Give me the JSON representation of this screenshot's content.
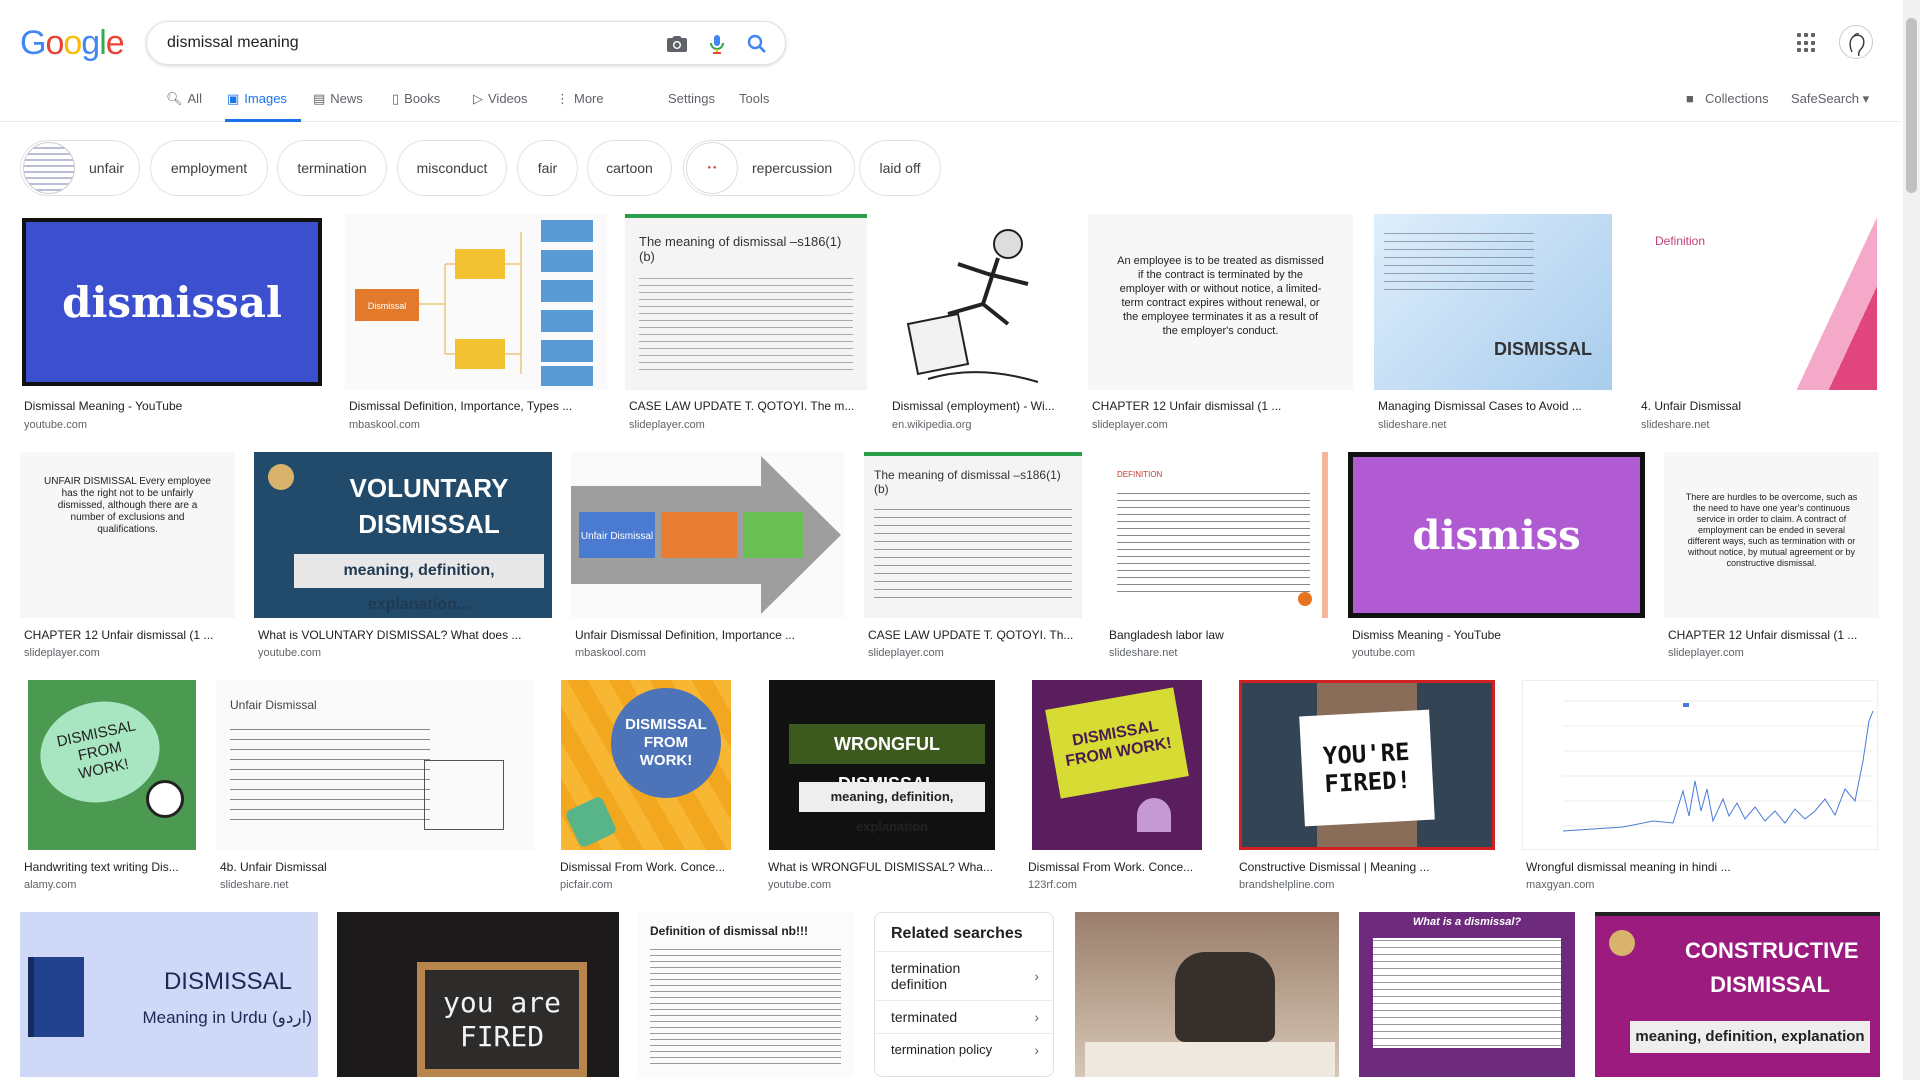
{
  "search": {
    "query": "dismissal meaning"
  },
  "logo": {
    "letters": [
      "G",
      "o",
      "o",
      "g",
      "l",
      "e"
    ],
    "colors": [
      "#4285f4",
      "#ea4335",
      "#fbbc05",
      "#4285f4",
      "#34a853",
      "#ea4335"
    ]
  },
  "tabs": [
    {
      "label": "All",
      "icon": "search-icon",
      "active": false
    },
    {
      "label": "Images",
      "icon": "image-icon",
      "active": true
    },
    {
      "label": "News",
      "icon": "news-icon",
      "active": false
    },
    {
      "label": "Books",
      "icon": "book-icon",
      "active": false
    },
    {
      "label": "Videos",
      "icon": "video-icon",
      "active": false
    },
    {
      "label": "More",
      "icon": "more-vert-icon",
      "active": false
    }
  ],
  "settings_label": "Settings",
  "tools_label": "Tools",
  "collections_label": "Collections",
  "safesearch_label": "SafeSearch",
  "chips": [
    "unfair",
    "employment",
    "termination",
    "misconduct",
    "fair",
    "cartoon",
    "repercussion",
    "laid off"
  ],
  "results": [
    [
      {
        "title": "Dismissal Meaning - YouTube",
        "src": "youtube.com",
        "text": "dismissal"
      },
      {
        "title": "Dismissal Definition, Importance, Types ...",
        "src": "mbaskool.com",
        "text": "Dismissal"
      },
      {
        "title": "CASE LAW UPDATE T. QOTOYI. The m...",
        "src": "slideplayer.com",
        "text": "The meaning of dismissal –s186(1)(b)"
      },
      {
        "title": "Dismissal (employment) - Wi...",
        "src": "en.wikipedia.org",
        "text": ""
      },
      {
        "title": "CHAPTER 12 Unfair dismissal (1 ...",
        "src": "slideplayer.com",
        "text": "An employee is to be treated as dismissed if the contract is terminated by the employer with or without notice, a limited-term contract expires without renewal, or the employee terminates it as a result of the employer's conduct."
      },
      {
        "title": "Managing Dismissal Cases to Avoid ...",
        "src": "slideshare.net",
        "text": "DISMISSAL"
      },
      {
        "title": "4. Unfair Dismissal",
        "src": "slideshare.net",
        "text": "Definition"
      }
    ],
    [
      {
        "title": "CHAPTER 12 Unfair dismissal (1 ...",
        "src": "slideplayer.com",
        "text": "UNFAIR DISMISSAL Every employee has the right not to be unfairly dismissed, although there are a number of exclusions and qualifications."
      },
      {
        "title": "What is VOLUNTARY DISMISSAL? What does ...",
        "src": "youtube.com",
        "text": "VOLUNTARY DISMISSAL",
        "sub": "meaning, definition, explanation..."
      },
      {
        "title": "Unfair Dismissal Definition, Importance ...",
        "src": "mbaskool.com",
        "text": "Unfair Dismissal"
      },
      {
        "title": "CASE LAW UPDATE T. QOTOYI. Th...",
        "src": "slideplayer.com",
        "text": "The meaning of dismissal –s186(1)(b)"
      },
      {
        "title": "Bangladesh labor law",
        "src": "slideshare.net",
        "text": "DEFINITION"
      },
      {
        "title": "Dismiss Meaning - YouTube",
        "src": "youtube.com",
        "text": "dismiss"
      },
      {
        "title": "CHAPTER 12 Unfair dismissal (1 ...",
        "src": "slideplayer.com",
        "text": "There are hurdles to be overcome, such as the need to have one year's continuous service in order to claim. A contract of employment can be ended in several different ways, such as termination with or without notice, by mutual agreement or by constructive dismissal."
      }
    ],
    [
      {
        "title": "Handwriting text writing Dis...",
        "src": "alamy.com",
        "text": "DISMISSAL FROM WORK!"
      },
      {
        "title": "4b. Unfair Dismissal",
        "src": "slideshare.net",
        "text": "Unfair Dismissal"
      },
      {
        "title": "Dismissal From Work. Conce...",
        "src": "picfair.com",
        "text": "DISMISSAL FROM WORK!"
      },
      {
        "title": "What is WRONGFUL DISMISSAL? Wha...",
        "src": "youtube.com",
        "text": "WRONGFUL DISMISSAL",
        "sub": "meaning, definition, explanation"
      },
      {
        "title": "Dismissal From Work. Conce...",
        "src": "123rf.com",
        "text": "DISMISSAL FROM WORK!"
      },
      {
        "title": "Constructive Dismissal | Meaning ...",
        "src": "brandshelpline.com",
        "text": "YOU'RE FIRED!"
      },
      {
        "title": "Wrongful dismissal meaning in hindi ...",
        "src": "maxgyan.com",
        "text": ""
      }
    ],
    [
      {
        "title": "",
        "src": "",
        "text": "DISMISSAL",
        "sub": "Meaning in Urdu (اردو)"
      },
      {
        "title": "",
        "src": "",
        "text": "you are FIRED"
      },
      {
        "title": "",
        "src": "",
        "text": "Definition of dismissal nb!!!"
      },
      {
        "title": "",
        "src": "",
        "text": ""
      },
      {
        "title": "",
        "src": "",
        "text": "What is a dismissal?"
      },
      {
        "title": "",
        "src": "",
        "text": "CONSTRUCTIVE DISMISSAL",
        "sub": "meaning, definition, explanation"
      }
    ]
  ],
  "related": {
    "heading": "Related searches",
    "items": [
      "termination definition",
      "terminated",
      "termination policy"
    ]
  }
}
